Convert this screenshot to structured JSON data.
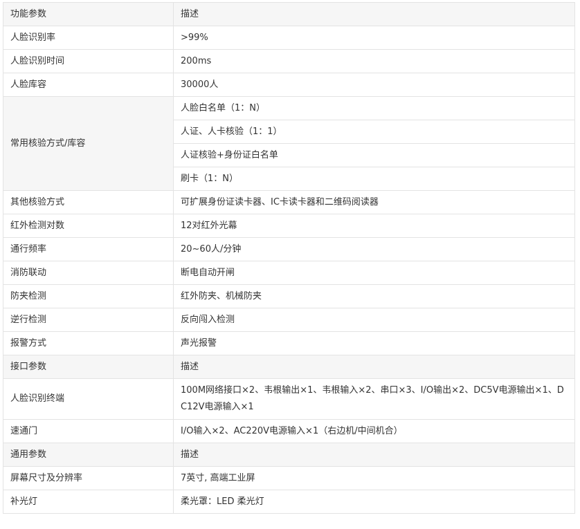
{
  "table": {
    "header1": {
      "col1": "功能参数",
      "col2": "描述"
    },
    "face_rate": {
      "label": "人脸识别率",
      "value": ">99%"
    },
    "face_time": {
      "label": "人脸识别时间",
      "value": "200ms"
    },
    "face_lib": {
      "label": "人脸库容",
      "value": "30000人"
    },
    "verify": {
      "label": "常用核验方式/库容",
      "values": [
        "人脸白名单（1：N）",
        "人证、人卡核验（1：1）",
        "人证核验+身份证白名单",
        "刷卡（1：N）"
      ]
    },
    "other_verify": {
      "label": "其他核验方式",
      "value": "可扩展身份证读卡器、IC卡读卡器和二维码阅读器"
    },
    "ir_count": {
      "label": "红外检测对数",
      "value": "12对红外光幕"
    },
    "freq": {
      "label": "通行频率",
      "value": "20~60人/分钟"
    },
    "fire": {
      "label": "消防联动",
      "value": "断电自动开闸"
    },
    "anti_pinch": {
      "label": "防夹检测",
      "value": "红外防夹、机械防夹"
    },
    "reverse": {
      "label": "逆行检测",
      "value": "反向闯入检测"
    },
    "alarm": {
      "label": "报警方式",
      "value": "声光报警"
    },
    "header2": {
      "col1": "接口参数",
      "col2": "描述"
    },
    "face_terminal": {
      "label": "人脸识别终端",
      "value": "100M网络接口×2、韦根输出×1、韦根输入×2、串口×3、I/O输出×2、DC5V电源输出×1、DC12V电源输入×1"
    },
    "speed_gate": {
      "label": "速通门",
      "value": "I/O输入×2、AC220V电源输入×1（右边机/中间机合）"
    },
    "header3": {
      "col1": "通用参数",
      "col2": "描述"
    },
    "screen": {
      "label": "屏幕尺寸及分辨率",
      "value": "7英寸, 高端工业屏"
    },
    "fill_light": {
      "label": "补光灯",
      "value": "柔光罩：LED 柔光灯"
    }
  }
}
